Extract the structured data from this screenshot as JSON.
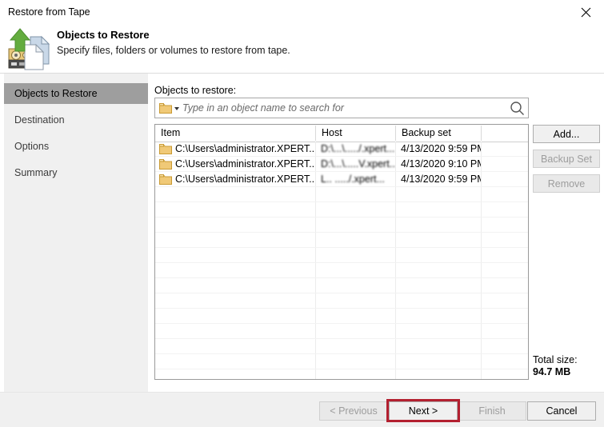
{
  "window": {
    "title": "Restore from Tape",
    "close_label": "✕"
  },
  "header": {
    "title": "Objects to Restore",
    "subtitle": "Specify files, folders or volumes to restore from tape.",
    "icon": "tape-restore-icon"
  },
  "sidebar": {
    "items": [
      {
        "label": "Objects to Restore",
        "selected": true
      },
      {
        "label": "Destination",
        "selected": false
      },
      {
        "label": "Options",
        "selected": false
      },
      {
        "label": "Summary",
        "selected": false
      }
    ]
  },
  "main": {
    "field_label": "Objects to restore:",
    "search": {
      "placeholder": "Type in an object name to search for",
      "value": "",
      "scope_icon": "folder-icon",
      "dropdown_icon": "chevron-down-icon",
      "search_icon": "search-icon"
    },
    "table": {
      "columns": [
        "Item",
        "Host",
        "Backup set",
        ""
      ],
      "rows": [
        {
          "item": "C:\\Users\\administrator.XPERT...",
          "host": "D:\\...\\...../.xpert...",
          "host_redacted": true,
          "backup_set": "4/13/2020 9:59 PM"
        },
        {
          "item": "C:\\Users\\administrator.XPERT...",
          "host": "D:\\...\\.....V.xpert...",
          "host_redacted": true,
          "backup_set": "4/13/2020 9:10 PM"
        },
        {
          "item": "C:\\Users\\administrator.XPERT...",
          "host": "L.. ...../.xpert...",
          "host_redacted": true,
          "backup_set": "4/13/2020 9:59 PM"
        }
      ]
    },
    "side_buttons": [
      {
        "label": "Add...",
        "enabled": true
      },
      {
        "label": "Backup Set",
        "enabled": false
      },
      {
        "label": "Remove",
        "enabled": false
      }
    ],
    "total": {
      "label": "Total size:",
      "value": "94.7 MB"
    }
  },
  "footer": {
    "buttons": [
      {
        "label": "< Previous",
        "enabled": false,
        "highlighted": false
      },
      {
        "label": "Next >",
        "enabled": true,
        "highlighted": true
      },
      {
        "label": "Finish",
        "enabled": false,
        "highlighted": false
      },
      {
        "label": "Cancel",
        "enabled": true,
        "highlighted": false
      }
    ]
  },
  "colors": {
    "highlight_border": "#b32030",
    "sidebar_selected_bg": "#9e9e9e",
    "folder_icon": "#f0c977",
    "arrow_green": "#5aa83c"
  }
}
